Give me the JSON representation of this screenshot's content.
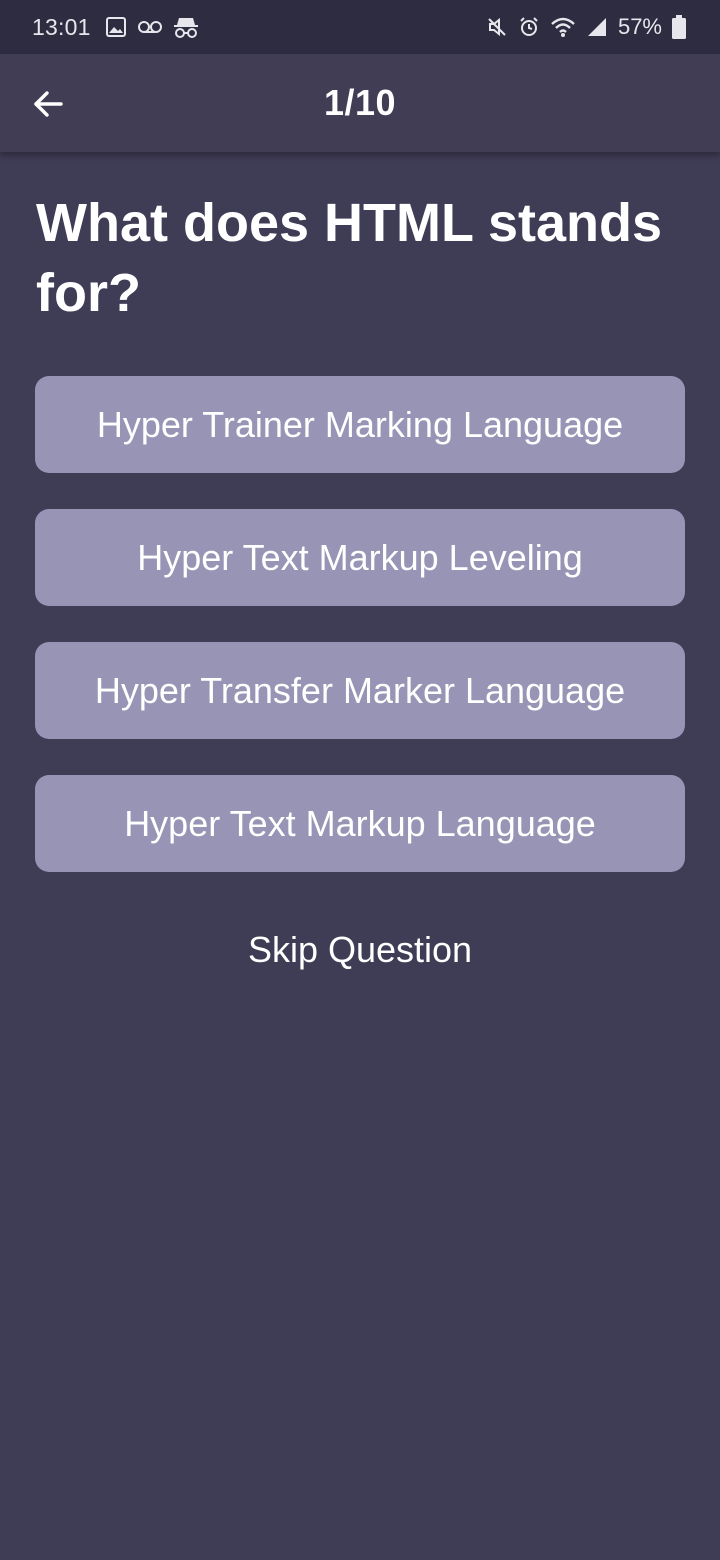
{
  "status_bar": {
    "time": "13:01",
    "battery_percent": "57%",
    "left_icons": [
      "image-icon",
      "voicemail-icon",
      "incognito-icon"
    ],
    "right_icons": [
      "mute-icon",
      "alarm-icon",
      "wifi-icon",
      "signal-icon",
      "battery-icon"
    ]
  },
  "app_bar": {
    "title": "1/10",
    "back_icon": "arrow-left-icon"
  },
  "question": {
    "text": "What does HTML stands for?"
  },
  "options": [
    {
      "label": "Hyper Trainer Marking Language"
    },
    {
      "label": "Hyper Text Markup Leveling"
    },
    {
      "label": "Hyper Transfer Marker Language"
    },
    {
      "label": "Hyper Text Markup Language"
    }
  ],
  "skip": {
    "label": "Skip Question"
  },
  "colors": {
    "background": "#3f3c55",
    "status_bar": "#2e2c40",
    "option_button": "#9794b5",
    "text": "#ffffff"
  }
}
